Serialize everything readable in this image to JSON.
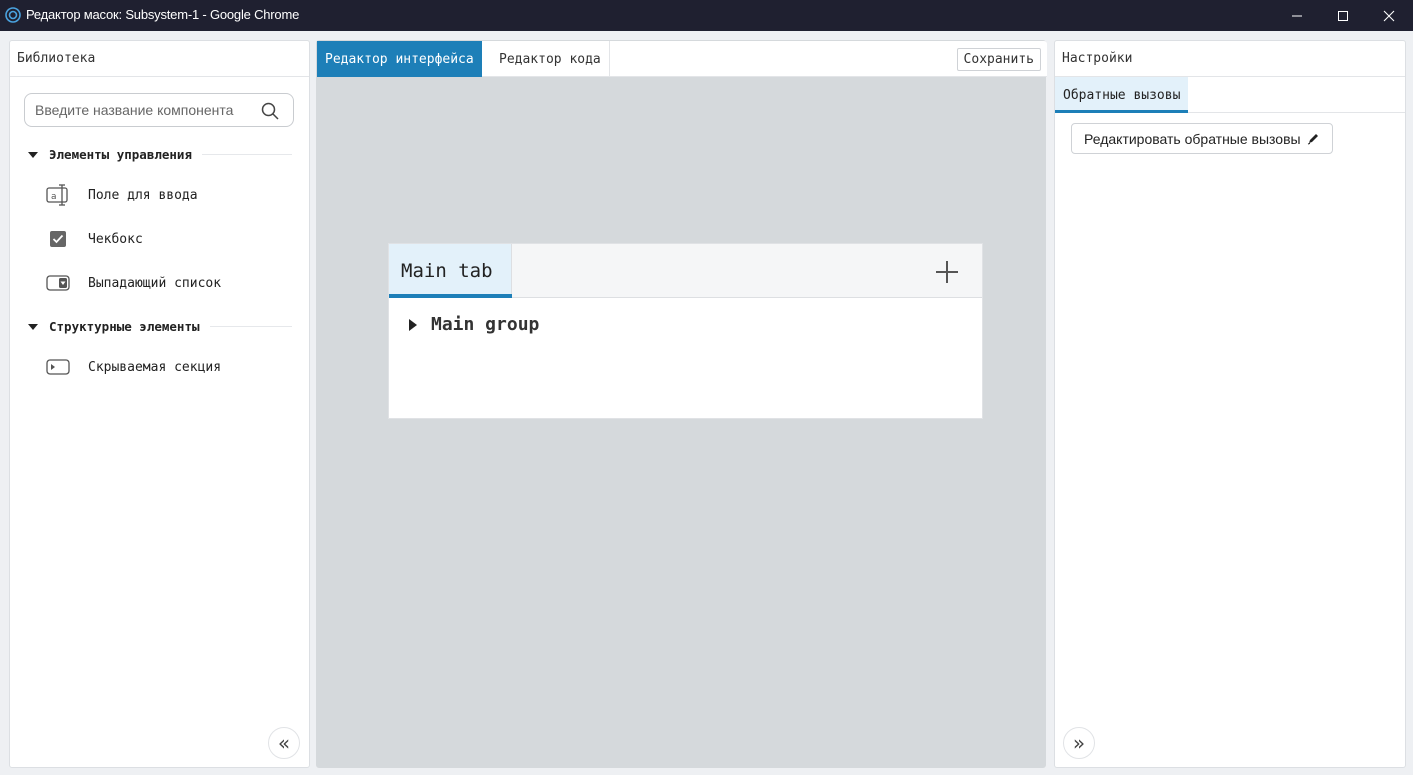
{
  "window": {
    "title": "Редактор масок: Subsystem-1 - Google Chrome"
  },
  "library": {
    "header": "Библиотека",
    "search_placeholder": "Введите название компонента",
    "sections": [
      {
        "label": "Элементы управления",
        "items": [
          {
            "label": "Поле для ввода",
            "icon": "text-input-icon"
          },
          {
            "label": "Чекбокс",
            "icon": "checkbox-icon"
          },
          {
            "label": "Выпадающий список",
            "icon": "dropdown-icon"
          }
        ]
      },
      {
        "label": "Структурные элементы",
        "items": [
          {
            "label": "Скрываемая секция",
            "icon": "collapsible-section-icon"
          }
        ]
      }
    ],
    "collapse_label": "«"
  },
  "editor": {
    "tabs": [
      {
        "label": "Редактор интерфейса",
        "active": true
      },
      {
        "label": "Редактор кода",
        "active": false
      }
    ],
    "save_label": "Сохранить",
    "canvas": {
      "tab_label": "Main tab",
      "group_label": "Main group"
    }
  },
  "settings": {
    "header": "Настройки",
    "tab_label": "Обратные вызовы",
    "edit_button_label": "Редактировать обратные вызовы",
    "expand_label": "»"
  },
  "colors": {
    "accent": "#1d7fb8",
    "titlebar": "#1f2030",
    "canvas_bg": "#d5d9dc",
    "active_tab_bg": "#e3f1fa"
  }
}
